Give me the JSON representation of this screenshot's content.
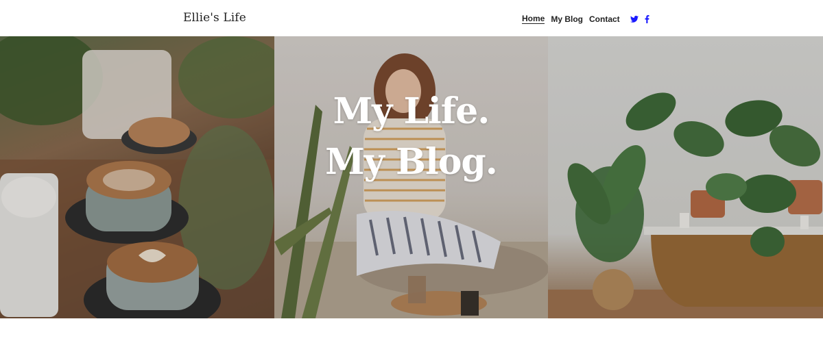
{
  "header": {
    "logo": "Ellie's Life",
    "nav": [
      {
        "label": "Home",
        "active": true
      },
      {
        "label": "My Blog",
        "active": false
      },
      {
        "label": "Contact",
        "active": false
      }
    ],
    "social": [
      {
        "icon": "twitter-icon",
        "color": "#1a1aff"
      },
      {
        "icon": "facebook-icon",
        "color": "#1a1aff"
      }
    ]
  },
  "hero": {
    "title_line1": "My Life.",
    "title_line2": "My Blog."
  }
}
